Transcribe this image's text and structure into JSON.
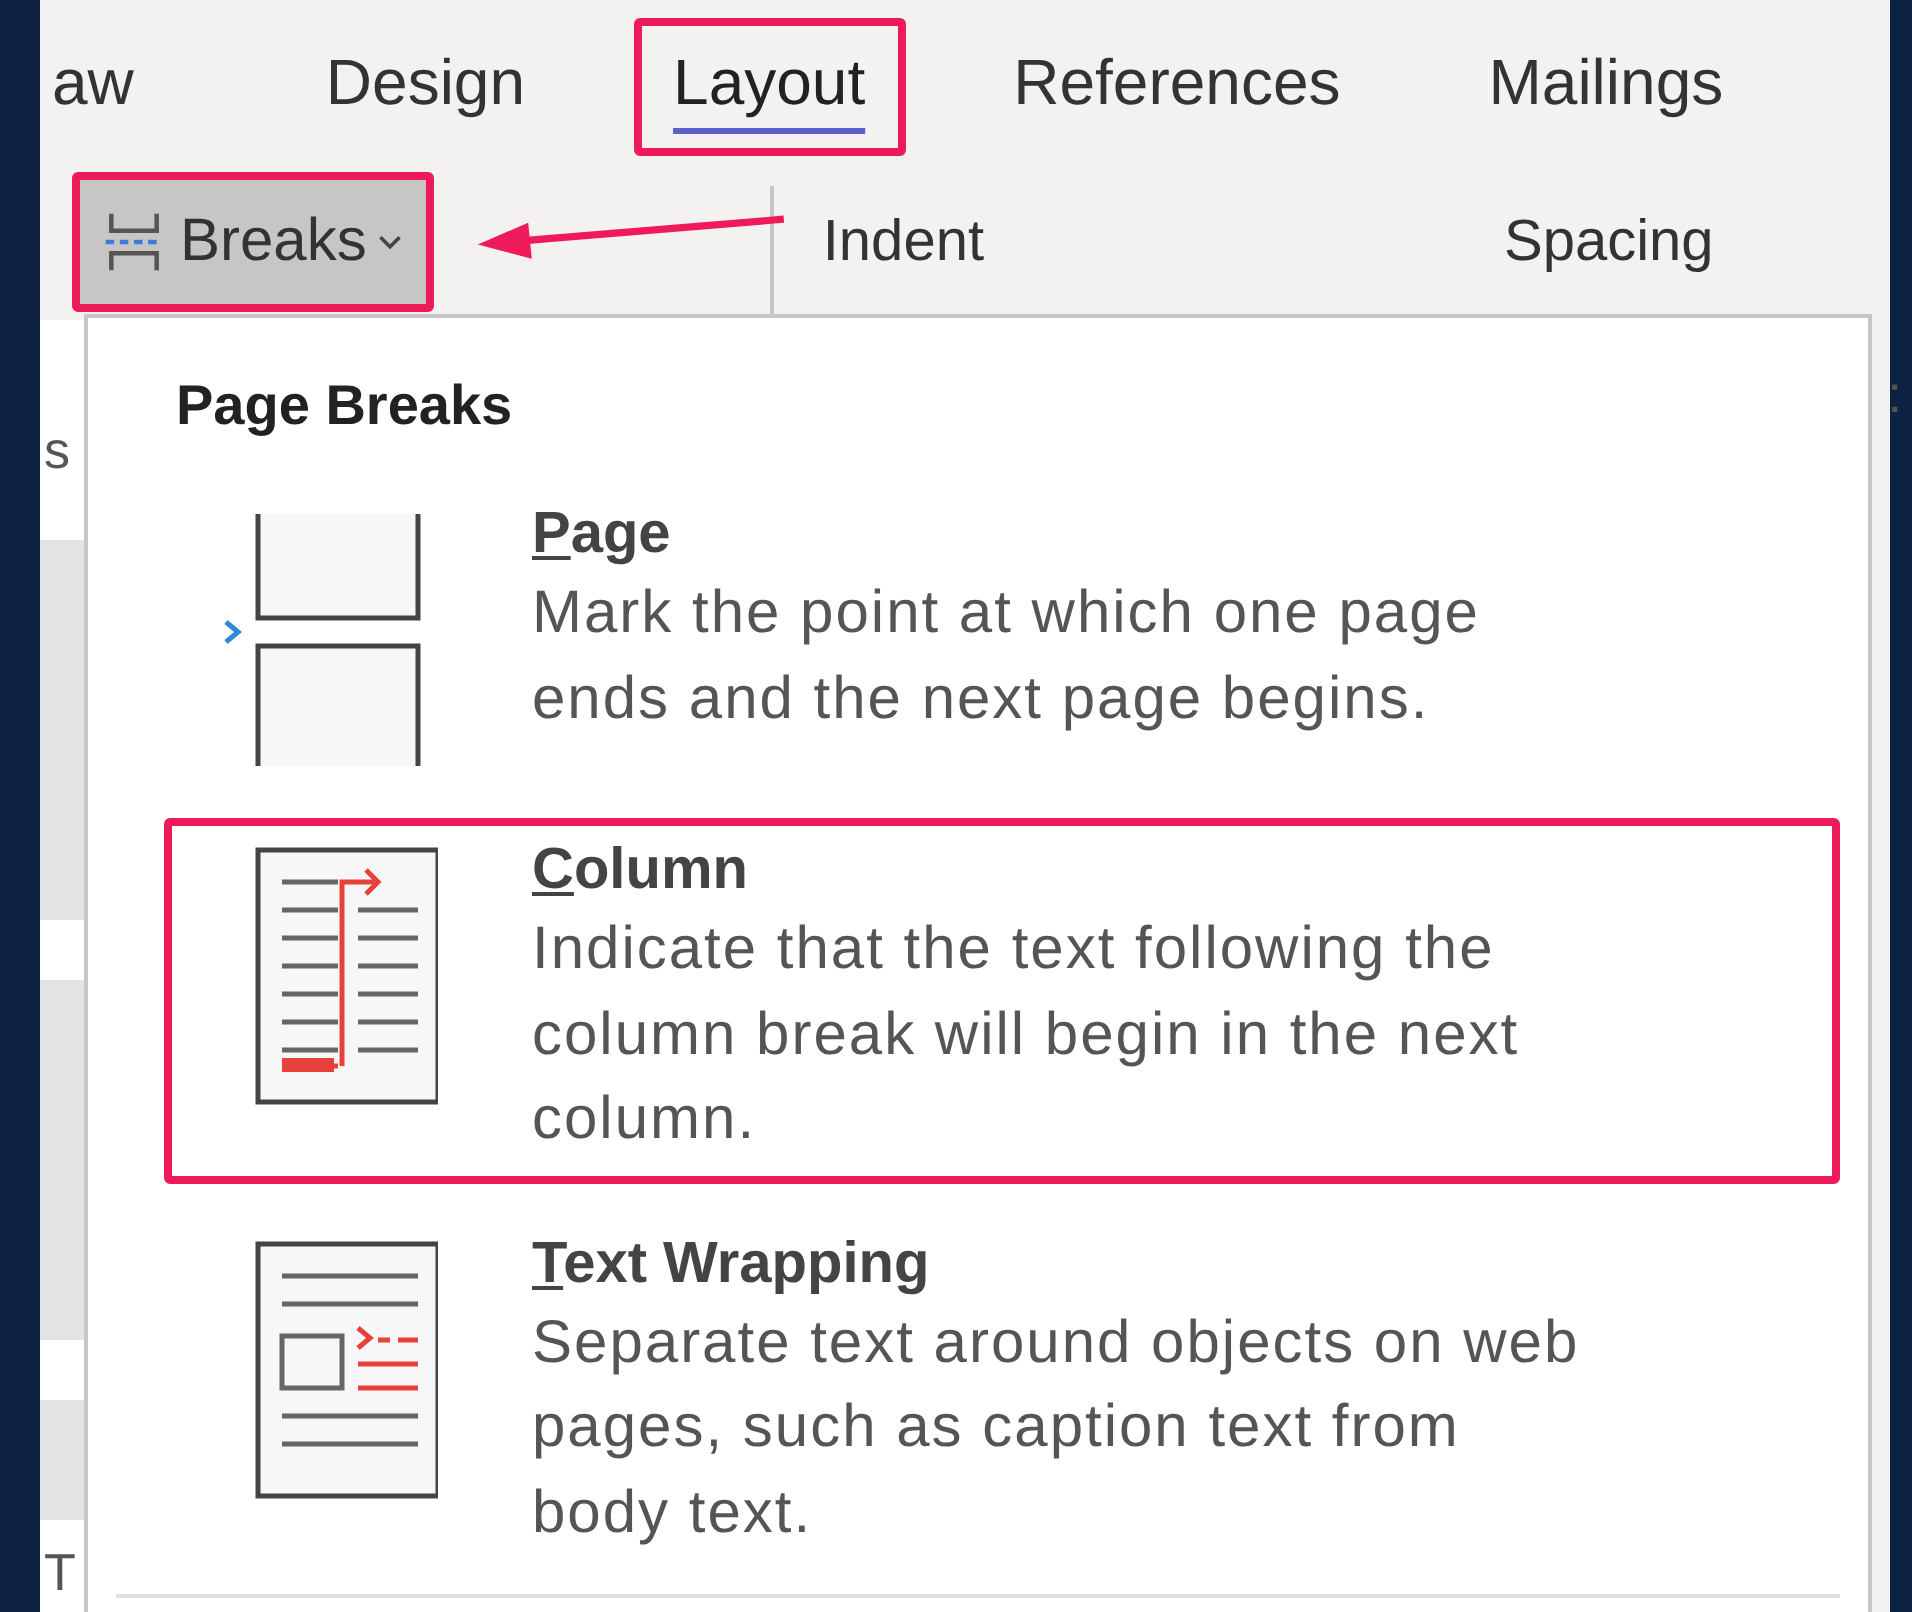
{
  "tabs": [
    {
      "label": "aw",
      "selected": false,
      "highlighted": false
    },
    {
      "label": "Design",
      "selected": false,
      "highlighted": false
    },
    {
      "label": "Layout",
      "selected": true,
      "highlighted": true
    },
    {
      "label": "References",
      "selected": false,
      "highlighted": false
    },
    {
      "label": "Mailings",
      "selected": false,
      "highlighted": false
    }
  ],
  "toolbar": {
    "breaks_button": {
      "label": "Breaks",
      "highlighted": true
    },
    "indent_label": "Indent",
    "spacing_label": "Spacing"
  },
  "background_fragments": {
    "left_top": "s",
    "left_bottom": "T",
    "right": ":"
  },
  "breaks_menu": {
    "heading": "Page Breaks",
    "items": [
      {
        "kind": "page",
        "title": "Page",
        "description": "Mark the point at which one page ends and the next page begins.",
        "highlighted": false
      },
      {
        "kind": "column",
        "title": "Column",
        "description": "Indicate that the text following the column break will begin in the next column.",
        "highlighted": true
      },
      {
        "kind": "text_wrapping",
        "title": "Text Wrapping",
        "description": "Separate text around objects on web pages, such as caption text from body text.",
        "highlighted": false
      }
    ]
  }
}
